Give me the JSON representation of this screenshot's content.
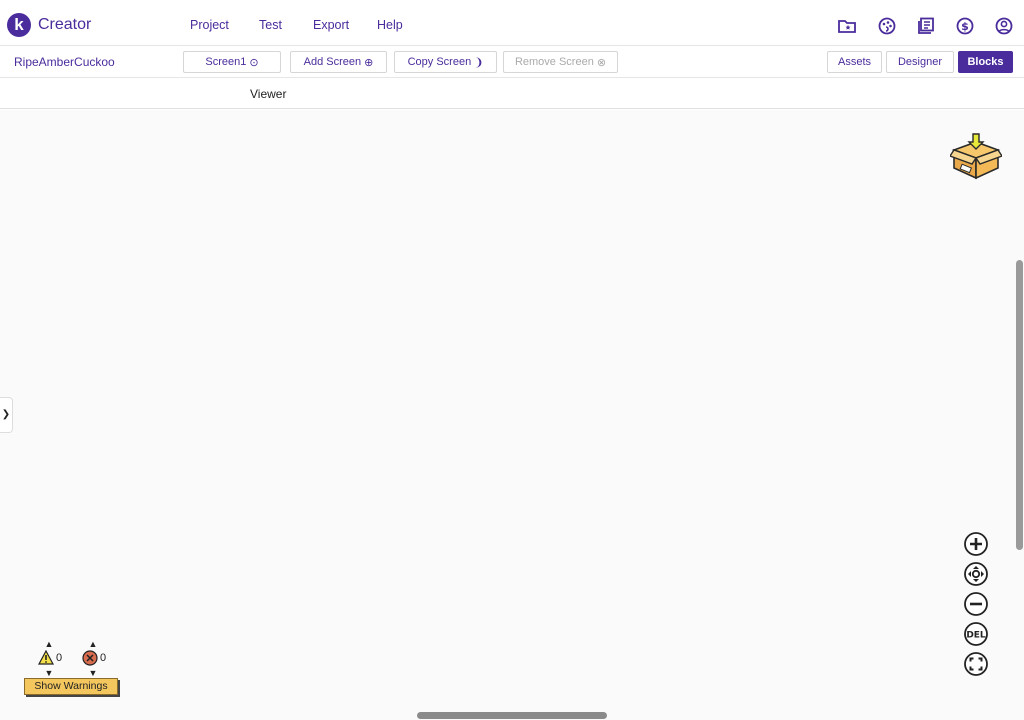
{
  "app": {
    "logo_letter": "k",
    "title": "Creator"
  },
  "menu": {
    "project": "Project",
    "test": "Test",
    "export": "Export",
    "help": "Help"
  },
  "top_icons": [
    "folder-star-icon",
    "palette-icon",
    "library-icon",
    "dollar-icon",
    "account-icon"
  ],
  "toolbar": {
    "project_name": "RipeAmberCuckoo",
    "screen_select": "Screen1",
    "add_screen": "Add Screen",
    "copy_screen": "Copy Screen",
    "remove_screen": "Remove Screen",
    "assets": "Assets",
    "designer": "Designer",
    "blocks": "Blocks"
  },
  "viewer": {
    "label": "Viewer"
  },
  "warnings": {
    "warning_count": "0",
    "error_count": "0",
    "show_warnings": "Show Warnings"
  },
  "zoom_controls": [
    "zoom-in-icon",
    "center-icon",
    "zoom-out-icon",
    "delete-icon",
    "fullscreen-icon"
  ],
  "colors": {
    "accent": "#4a2c9c",
    "warning_button": "#f3c65e",
    "workspace": "#fafafa",
    "error_icon": "#d86c4f",
    "warning_icon": "#f5e04a"
  }
}
